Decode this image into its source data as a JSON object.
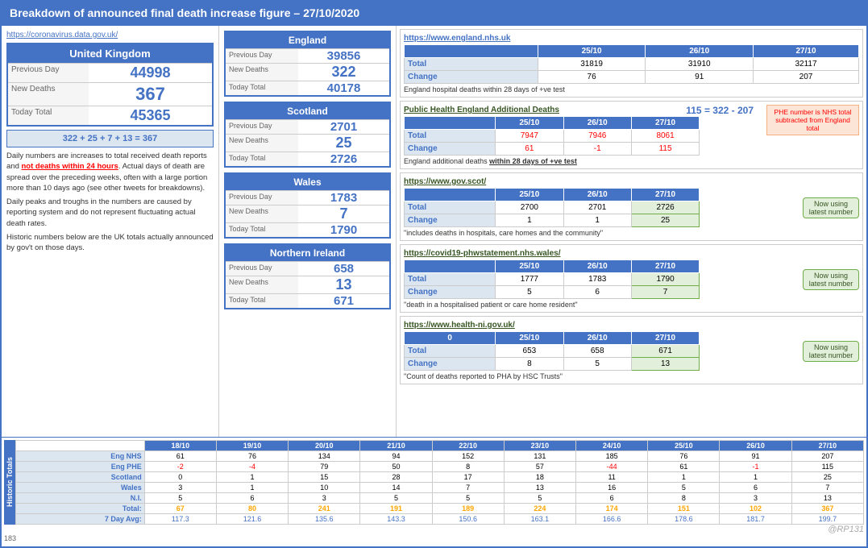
{
  "header": {
    "title": "Breakdown of announced final death increase figure – 27/10/2020"
  },
  "left": {
    "source_link": "https://coronavirus.data.gov.uk/",
    "uk_header": "United Kingdom",
    "previous_day_label": "Previous Day",
    "previous_day_value": "44998",
    "new_deaths_label": "New Deaths",
    "new_deaths_value": "367",
    "today_total_label": "Today Total",
    "today_total_value": "45365",
    "equation": "322 + 25 + 7 + 13 = 367",
    "desc1": "Daily numbers are increases to total received death reports and ",
    "desc1_red": "not deaths within 24 hours",
    "desc1_end": ". Actual days of death are spread over the preceding weeks, often with a large portion more than 10 days ago (see other tweets for breakdowns).",
    "desc2": "Daily peaks and troughs in the numbers are caused by reporting system and do not represent fluctuating actual death rates.",
    "desc3": "Historic numbers below are the UK totals actually announced by gov't on those days."
  },
  "middle": {
    "england": {
      "header": "England",
      "prev_day_label": "Previous Day",
      "prev_day_value": "39856",
      "new_deaths_label": "New Deaths",
      "new_deaths_value": "322",
      "today_total_label": "Today Total",
      "today_total_value": "40178"
    },
    "scotland": {
      "header": "Scotland",
      "prev_day_label": "Previous Day",
      "prev_day_value": "2701",
      "new_deaths_label": "New Deaths",
      "new_deaths_value": "25",
      "today_total_label": "Today Total",
      "today_total_value": "2726"
    },
    "wales": {
      "header": "Wales",
      "prev_day_label": "Previous Day",
      "prev_day_value": "1783",
      "new_deaths_label": "New Deaths",
      "new_deaths_value": "7",
      "today_total_label": "Today Total",
      "today_total_value": "1790"
    },
    "ni": {
      "header": "Northern Ireland",
      "prev_day_label": "Previous Day",
      "prev_day_value": "658",
      "new_deaths_label": "New Deaths",
      "new_deaths_value": "13",
      "today_total_label": "Today Total",
      "today_total_value": "671"
    }
  },
  "right": {
    "nhs": {
      "link": "https://www.england.nhs.uk",
      "col1": "25/10",
      "col2": "26/10",
      "col3": "27/10",
      "total_label": "Total",
      "total_25": "31819",
      "total_26": "31910",
      "total_27": "32117",
      "change_label": "Change",
      "change_25": "76",
      "change_26": "91",
      "change_27": "207",
      "note": "England hospital deaths within 28 days of +ve test"
    },
    "phe": {
      "link": "Public Health England Additional Deaths",
      "col1": "25/10",
      "col2": "26/10",
      "col3": "27/10",
      "total_label": "Total",
      "total_25": "7947",
      "total_26": "7946",
      "total_27": "8061",
      "change_label": "Change",
      "change_25": "61",
      "change_26": "-1",
      "change_27": "115",
      "equation": "115 = 322 - 207",
      "phe_note": "PHE number is NHS total subtracted from England total",
      "note_underline": "within 28 days of +ve test",
      "note_prefix": "England additional deaths "
    },
    "scot": {
      "link": "https://www.gov.scot/",
      "col1": "25/10",
      "col2": "26/10",
      "col3": "27/10",
      "total_label": "Total",
      "total_25": "2700",
      "total_26": "2701",
      "total_27": "2726",
      "change_label": "Change",
      "change_25": "1",
      "change_26": "1",
      "change_27": "25",
      "note": "\"includes deaths in hospitals, care homes and the community\"",
      "badge": "Now using latest number"
    },
    "wales": {
      "link": "https://covid19-phwstatement.nhs.wales/",
      "col1": "25/10",
      "col2": "26/10",
      "col3": "27/10",
      "total_label": "Total",
      "total_25": "1777",
      "total_26": "1783",
      "total_27": "1790",
      "change_label": "Change",
      "change_25": "5",
      "change_26": "6",
      "change_27": "7",
      "note": "\"death in a hospitalised patient or care home resident\"",
      "badge": "Now using latest number"
    },
    "ni": {
      "link": "https://www.health-ni.gov.uk/",
      "col1_label": "0",
      "col1": "25/10",
      "col2": "26/10",
      "col3": "27/10",
      "total_label": "Total",
      "total_25": "653",
      "total_26": "658",
      "total_27": "671",
      "change_label": "Change",
      "change_25": "8",
      "change_26": "5",
      "change_27": "13",
      "note": "\"Count of deaths reported to PHA by HSC Trusts\"",
      "badge": "Now using latest number"
    }
  },
  "historic": {
    "dates": [
      "18/10",
      "19/10",
      "20/10",
      "21/10",
      "22/10",
      "23/10",
      "24/10",
      "25/10",
      "26/10",
      "27/10"
    ],
    "rows": [
      {
        "label": "Eng NHS",
        "values": [
          "61",
          "76",
          "134",
          "94",
          "152",
          "131",
          "185",
          "76",
          "91",
          "207"
        ]
      },
      {
        "label": "Eng PHE",
        "values": [
          "-2",
          "-4",
          "79",
          "50",
          "8",
          "57",
          "-44",
          "61",
          "-1",
          "115"
        ]
      },
      {
        "label": "Scotland",
        "values": [
          "0",
          "1",
          "15",
          "28",
          "17",
          "18",
          "11",
          "1",
          "1",
          "25"
        ]
      },
      {
        "label": "Wales",
        "values": [
          "3",
          "1",
          "10",
          "14",
          "7",
          "13",
          "16",
          "5",
          "6",
          "7"
        ]
      },
      {
        "label": "N.I.",
        "values": [
          "5",
          "6",
          "3",
          "5",
          "5",
          "5",
          "6",
          "8",
          "3",
          "13"
        ]
      }
    ],
    "totals_label": "Total:",
    "totals": [
      "67",
      "80",
      "241",
      "191",
      "189",
      "224",
      "174",
      "151",
      "102",
      "367"
    ],
    "avg_label": "7 Day Avg:",
    "avgs": [
      "117.3",
      "121.6",
      "135.6",
      "143.3",
      "150.6",
      "163.1",
      "166.6",
      "178.6",
      "181.7",
      "199.7"
    ],
    "side_label": "Historic Totals"
  },
  "watermark": "@RP131",
  "page_number": "183"
}
